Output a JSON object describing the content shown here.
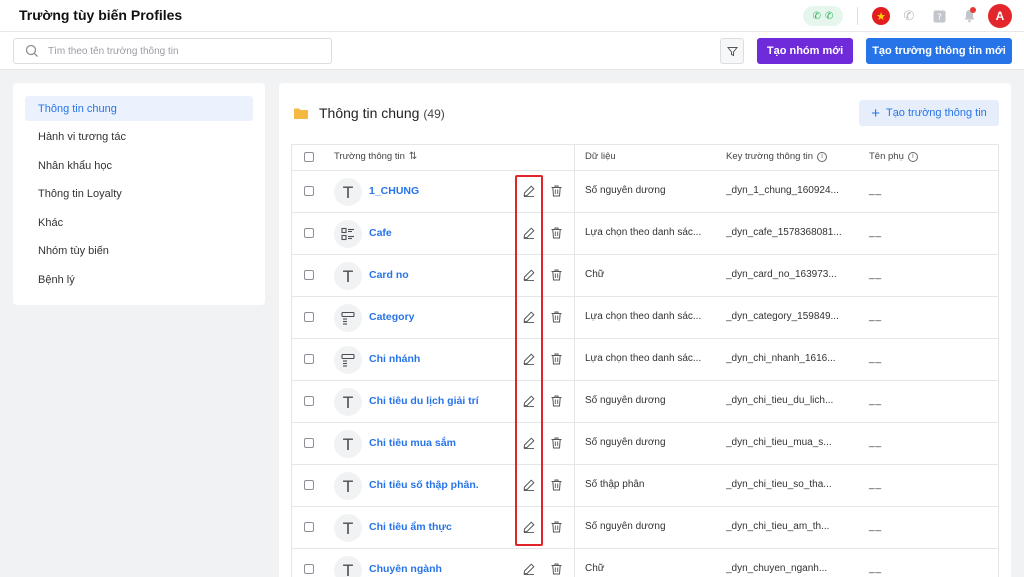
{
  "header": {
    "title": "Trường tùy biến Profiles",
    "avatar_letter": "A",
    "icons": [
      "phone-call-icon",
      "flag-vn-icon",
      "phone-icon",
      "help-icon",
      "bell-icon"
    ]
  },
  "toolbar": {
    "search_placeholder": "Tìm theo tên trường thông tin",
    "create_group_label": "Tạo nhóm mới",
    "create_field_label": "Tạo trường thông tin mới"
  },
  "sidebar": {
    "items": [
      {
        "label": "Thông tin chung",
        "active": true
      },
      {
        "label": "Hành vi tương tác",
        "active": false
      },
      {
        "label": "Nhân khẩu học",
        "active": false
      },
      {
        "label": "Thông tin Loyalty",
        "active": false
      },
      {
        "label": "Khác",
        "active": false
      },
      {
        "label": "Nhóm tùy biến",
        "active": false
      },
      {
        "label": "Bệnh lý",
        "active": false
      }
    ]
  },
  "main": {
    "title": "Thông tin chung",
    "count": "(49)",
    "add_button_label": "Tạo trường thông tin",
    "columns": {
      "name": "Trường thông tin",
      "data": "Dữ liệu",
      "key": "Key trường thông tin",
      "subname": "Tên phụ"
    },
    "rows": [
      {
        "icon": "text",
        "name": "1_CHUNG",
        "data": "Số nguyên dương",
        "key": "_dyn_1_chung_160924...",
        "sub": "__"
      },
      {
        "icon": "list",
        "name": "Cafe",
        "data": "Lựa chọn theo danh sác...",
        "key": "_dyn_cafe_1578368081...",
        "sub": "__"
      },
      {
        "icon": "text",
        "name": "Card no",
        "data": "Chữ",
        "key": "_dyn_card_no_163973...",
        "sub": "__"
      },
      {
        "icon": "dropdown",
        "name": "Category",
        "data": "Lựa chọn theo danh sác...",
        "key": "_dyn_category_159849...",
        "sub": "__"
      },
      {
        "icon": "dropdown",
        "name": "Chi nhánh",
        "data": "Lựa chọn theo danh sác...",
        "key": "_dyn_chi_nhanh_1616...",
        "sub": "__"
      },
      {
        "icon": "text",
        "name": "Chi tiêu du lịch giải trí",
        "data": "Số nguyên dương",
        "key": "_dyn_chi_tieu_du_lich...",
        "sub": "__"
      },
      {
        "icon": "text",
        "name": "Chi tiêu mua sắm",
        "data": "Số nguyên dương",
        "key": "_dyn_chi_tieu_mua_s...",
        "sub": "__"
      },
      {
        "icon": "text",
        "name": "Chi tiêu số thập phân.",
        "data": "Số thập phân",
        "key": "_dyn_chi_tieu_so_tha...",
        "sub": "__"
      },
      {
        "icon": "text",
        "name": "Chi tiêu ẩm thực",
        "data": "Số nguyên dương",
        "key": "_dyn_chi_tieu_am_th...",
        "sub": "__"
      },
      {
        "icon": "text",
        "name": "Chuyên ngành",
        "data": "Chữ",
        "key": "_dyn_chuyen_nganh...",
        "sub": "__"
      }
    ]
  },
  "colors": {
    "primary": "#2774e8",
    "purple": "#6f2bd9",
    "highlight": "#e0242a"
  }
}
